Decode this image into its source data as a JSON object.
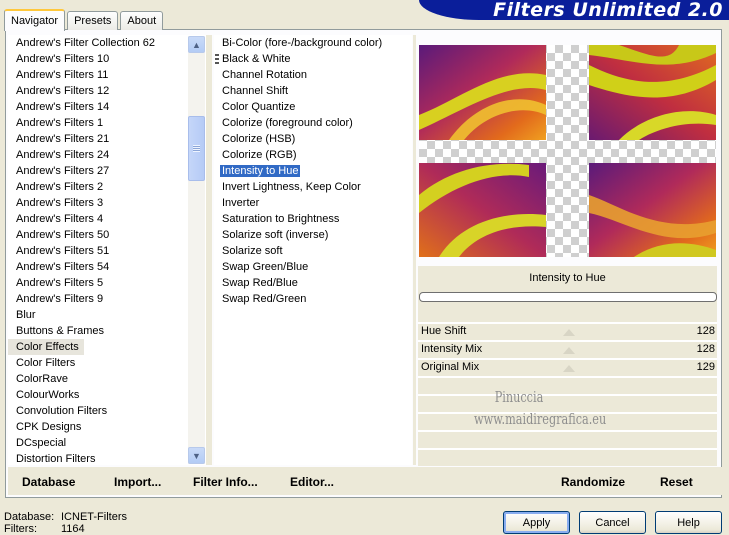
{
  "tabs": [
    {
      "label": "Navigator",
      "active": true
    },
    {
      "label": "Presets",
      "active": false
    },
    {
      "label": "About",
      "active": false
    }
  ],
  "banner_title": "Filters Unlimited 2.0",
  "categories": [
    "Andrew's Filter Collection 62",
    "Andrew's Filters 10",
    "Andrew's Filters 11",
    "Andrew's Filters 12",
    "Andrew's Filters 14",
    "Andrew's Filters 1",
    "Andrew's Filters 21",
    "Andrew's Filters 24",
    "Andrew's Filters 27",
    "Andrew's Filters 2",
    "Andrew's Filters 3",
    "Andrew's Filters 4",
    "Andrew's Filters 50",
    "Andrew's Filters 51",
    "Andrew's Filters 54",
    "Andrew's Filters 5",
    "Andrew's Filters 9",
    "Blur",
    "Buttons & Frames",
    "Color Effects",
    "Color Filters",
    "ColorRave",
    "ColourWorks",
    "Convolution Filters",
    "CPK Designs",
    "DCspecial",
    "Distortion Filters"
  ],
  "selected_category": "Color Effects",
  "filters": [
    "Bi-Color (fore-/background color)",
    "Black & White",
    "Channel Rotation",
    "Channel Shift",
    "Color Quantize",
    "Colorize (foreground color)",
    "Colorize (HSB)",
    "Colorize (RGB)",
    "Intensity to Hue",
    "Invert Lightness, Keep Color",
    "Inverter",
    "Saturation to Brightness",
    "Solarize soft (inverse)",
    "Solarize soft",
    "Swap Green/Blue",
    "Swap Red/Blue",
    "Swap Red/Green"
  ],
  "selected_filter": "Intensity to Hue",
  "filter_title": "Intensity to Hue",
  "params": [
    {
      "label": "Hue Shift",
      "value": "128"
    },
    {
      "label": "Intensity Mix",
      "value": "128"
    },
    {
      "label": "Original Mix",
      "value": "129"
    }
  ],
  "watermark": {
    "line1": "Pinuccia",
    "line2": "www.maidiregrafica.eu"
  },
  "bottom_buttons": {
    "database": "Database",
    "import": "Import...",
    "filter_info": "Filter Info...",
    "editor": "Editor...",
    "randomize": "Randomize",
    "reset": "Reset"
  },
  "status": {
    "database_label": "Database:",
    "database_value": "ICNET-Filters",
    "filters_label": "Filters:",
    "filters_value": "1164"
  },
  "dialog_buttons": {
    "apply": "Apply",
    "cancel": "Cancel",
    "help": "Help"
  },
  "colors": {
    "selection": "#316ac5",
    "banner": "#0a1e9a",
    "face": "#ece9d8"
  }
}
